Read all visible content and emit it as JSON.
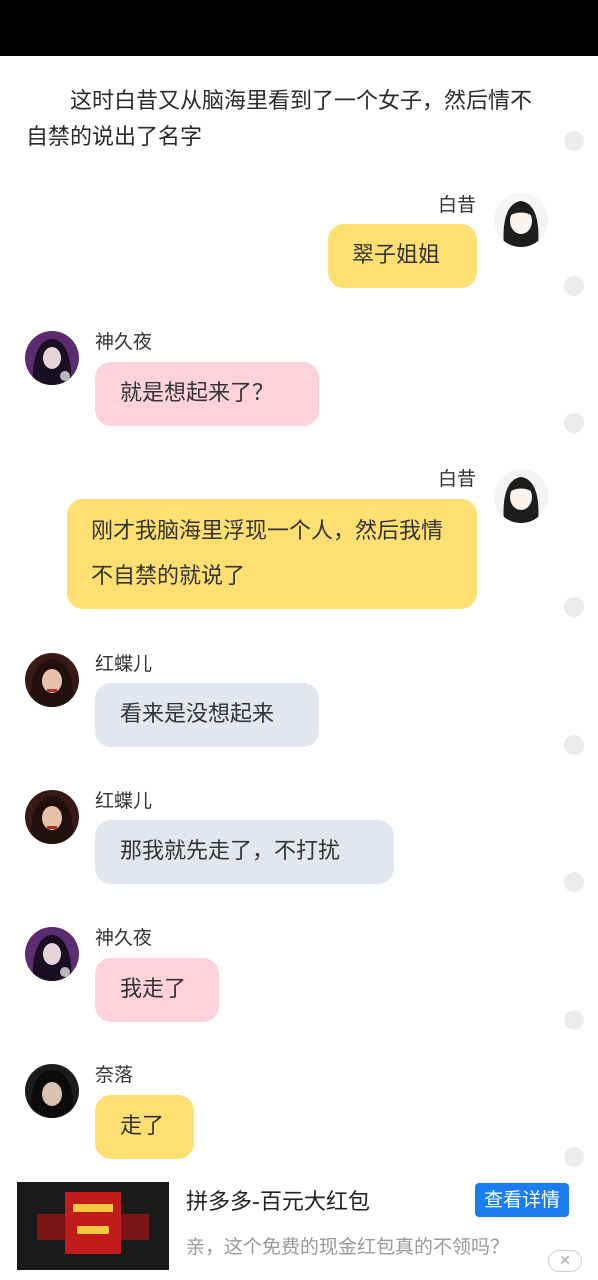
{
  "narration": "这时白昔又从脑海里看到了一个女子，然后情不自禁的说出了名字",
  "messages": [
    {
      "speaker": "白昔",
      "text": "翠子姐姐"
    },
    {
      "speaker": "神久夜",
      "text": "就是想起来了？"
    },
    {
      "speaker": "白昔",
      "text": "刚才我脑海里浮现一个人，然后我情不自禁的就说了"
    },
    {
      "speaker": "红蝶儿",
      "text": "看来是没想起来"
    },
    {
      "speaker": "红蝶儿",
      "text": "那我就先走了，不打扰"
    },
    {
      "speaker": "神久夜",
      "text": "我走了"
    },
    {
      "speaker": "奈落",
      "text": "走了"
    }
  ],
  "ad": {
    "title": "拼多多-百元大红包",
    "subtitle": "亲，这个免费的现金红包真的不领吗？",
    "button": "查看详情",
    "close": "✕"
  },
  "colors": {
    "bubble_yellow": "#fedf72",
    "bubble_pink": "#fdd2dd",
    "bubble_gray": "#e2e7ef",
    "ad_button": "#1a7ef0"
  }
}
